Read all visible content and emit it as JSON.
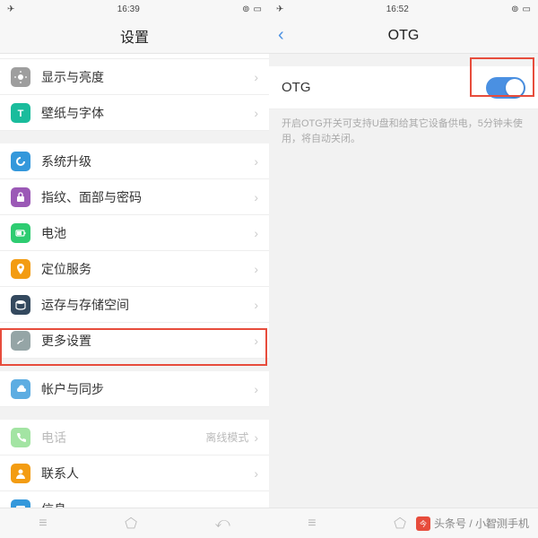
{
  "left": {
    "status": {
      "time": "16:39"
    },
    "title": "设置",
    "rows": [
      {
        "label": "显示与亮度",
        "color": "#9e9e9e",
        "glyph": "sun"
      },
      {
        "label": "壁纸与字体",
        "color": "#1abc9c",
        "glyph": "T"
      },
      {
        "label": "系统升级",
        "color": "#3498db",
        "glyph": "refresh"
      },
      {
        "label": "指纹、面部与密码",
        "color": "#9b59b6",
        "glyph": "lock"
      },
      {
        "label": "电池",
        "color": "#2ecc71",
        "glyph": "battery"
      },
      {
        "label": "定位服务",
        "color": "#f39c12",
        "glyph": "pin"
      },
      {
        "label": "运存与存储空间",
        "color": "#34495e",
        "glyph": "disk"
      },
      {
        "label": "更多设置",
        "color": "#95a5a6",
        "glyph": "wrench"
      },
      {
        "label": "帐户与同步",
        "color": "#5dade2",
        "glyph": "cloud"
      },
      {
        "label": "电话",
        "color": "#a3e4a3",
        "glyph": "phone",
        "dim": true,
        "detail": "离线模式"
      },
      {
        "label": "联系人",
        "color": "#f39c12",
        "glyph": "user"
      },
      {
        "label": "信息",
        "color": "#3498db",
        "glyph": "msg"
      }
    ],
    "groups": [
      [
        0,
        1
      ],
      [
        2,
        3,
        4,
        5,
        6,
        7
      ],
      [
        8
      ],
      [
        9,
        10,
        11
      ]
    ]
  },
  "right": {
    "status": {
      "time": "16:52"
    },
    "title": "OTG",
    "otg": {
      "label": "OTG",
      "on": true
    },
    "desc": "开启OTG开关可支持U盘和给其它设备供电，5分钟未使用，将自动关闭。"
  },
  "watermark": "头条号 / 小智测手机"
}
